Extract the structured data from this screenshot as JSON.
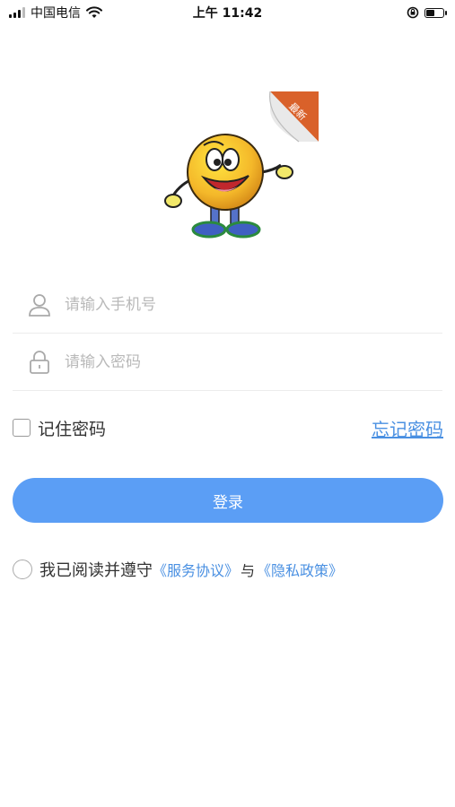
{
  "status_bar": {
    "carrier": "中国电信",
    "time": "上午 11:42",
    "battery_level": 0.5
  },
  "logo": {
    "badge_text": "最新"
  },
  "form": {
    "phone_placeholder": "请输入手机号",
    "password_placeholder": "请输入密码",
    "remember_label": "记住密码",
    "remember_checked": false,
    "forgot_label": "忘记密码",
    "login_label": "登录"
  },
  "agreement": {
    "prefix": "我已阅读并遵守",
    "service_link": "《服务协议》",
    "conjunction": "与",
    "privacy_link": "《隐私政策》",
    "checked": false
  },
  "colors": {
    "accent": "#5b9ef5",
    "link": "#4a90e2"
  },
  "icons": [
    "signal-icon",
    "wifi-icon",
    "lock-rotation-icon",
    "battery-icon",
    "user-icon",
    "lock-icon"
  ]
}
